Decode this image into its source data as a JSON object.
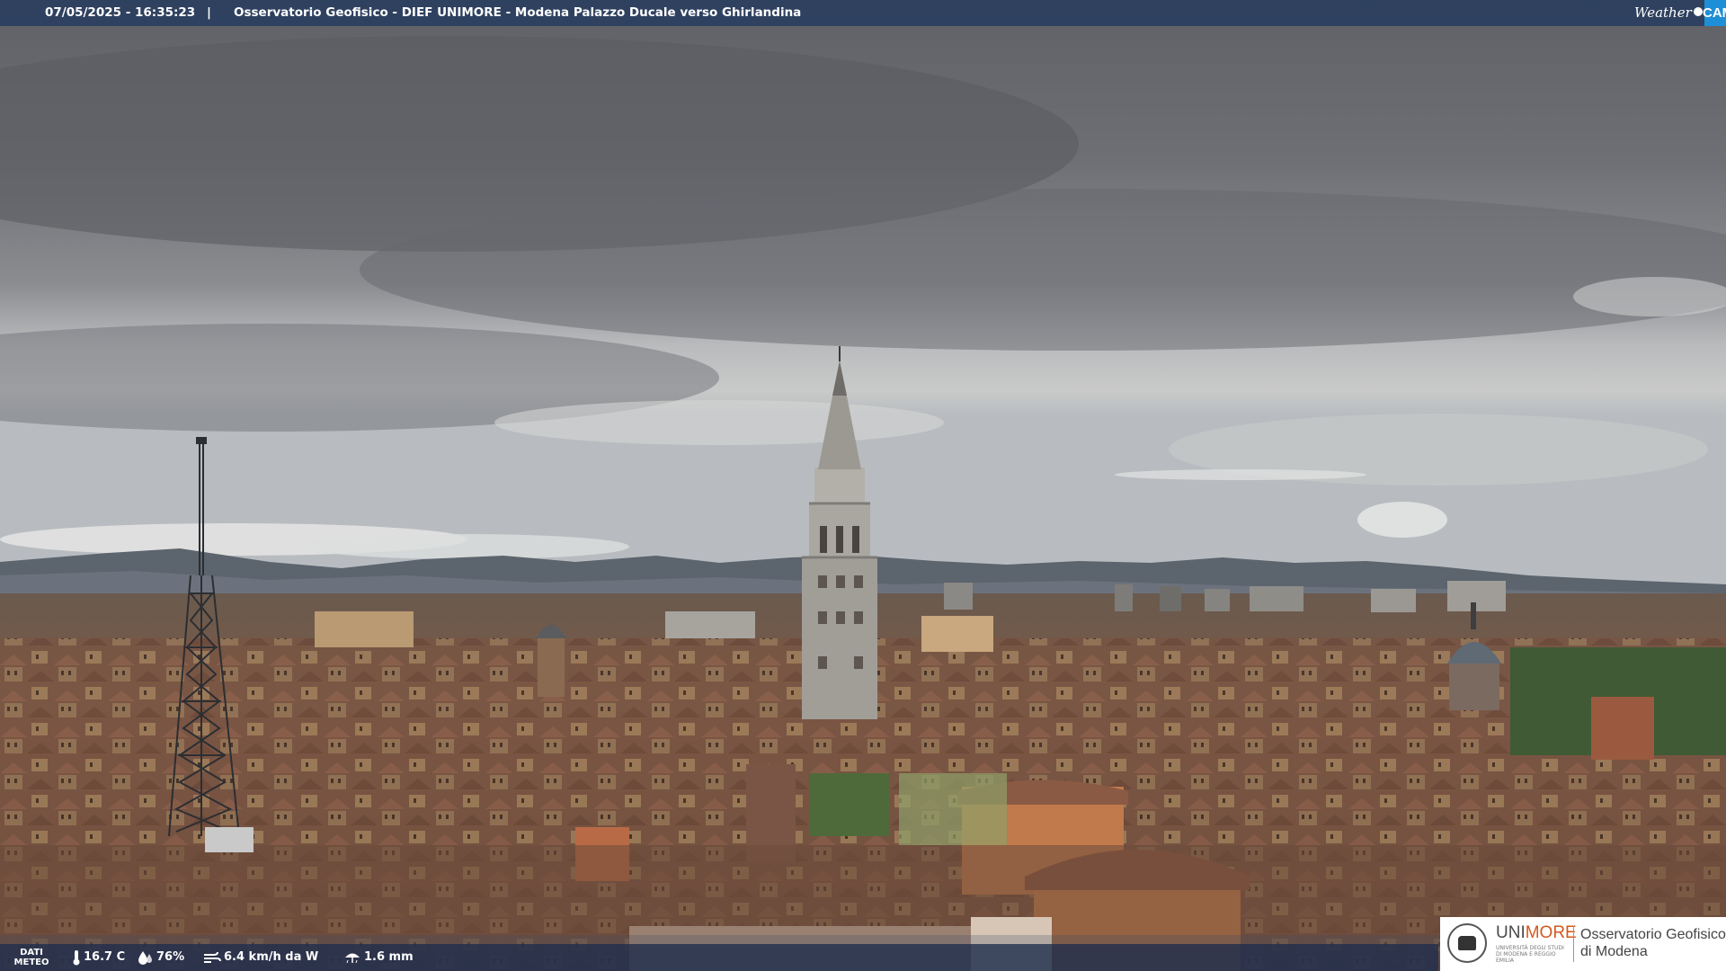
{
  "header": {
    "timestamp": "07/05/2025 - 16:35:23",
    "separator": "|",
    "title": "Osservatorio Geofisico - DIEF UNIMORE - Modena Palazzo Ducale verso Ghirlandina"
  },
  "brand": {
    "weather": "Weather",
    "cam": "CAM",
    "accent": "#1d8fd6"
  },
  "weather": {
    "label_line1": "DATI",
    "label_line2": "METEO",
    "temperature": "16.7 C",
    "humidity": "76%",
    "wind": "6.4 km/h da W",
    "rain": "1.6 mm",
    "icons": [
      "thermometer-icon",
      "humidity-icon",
      "wind-icon",
      "rain-icon"
    ]
  },
  "logo": {
    "uni_part1": "UNI",
    "uni_part2": "MORE",
    "uni_subtitle": "UNIVERSITÀ DEGLI STUDI DI MODENA E REGGIO EMILIA",
    "observatory_line1": "Osservatorio Geofisico",
    "observatory_line2": "di Modena",
    "accent": "#d25a1e"
  }
}
